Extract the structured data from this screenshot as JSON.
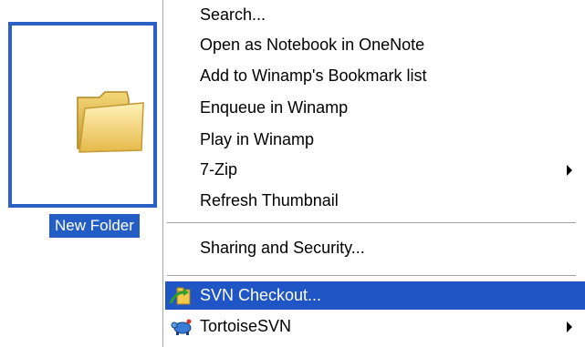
{
  "folder": {
    "label": "New Folder",
    "icon": "folder-icon"
  },
  "menu": {
    "items": [
      {
        "label": "Search..."
      },
      {
        "label": "Open as Notebook in OneNote"
      },
      {
        "label": "Add to Winamp's Bookmark list"
      },
      {
        "label": "Enqueue in Winamp"
      },
      {
        "label": "Play in Winamp"
      },
      {
        "label": "7-Zip",
        "submenu": true
      },
      {
        "label": "Refresh Thumbnail"
      },
      {
        "label": "Sharing and Security..."
      },
      {
        "label": "SVN Checkout...",
        "icon": "svn-checkout-icon",
        "highlighted": true
      },
      {
        "label": "TortoiseSVN",
        "icon": "tortoisesvn-icon",
        "submenu": true
      }
    ]
  },
  "colors": {
    "selection": "#245ec5",
    "menu_highlight": "#1f55c5",
    "folder_border": "#2b60c4"
  }
}
